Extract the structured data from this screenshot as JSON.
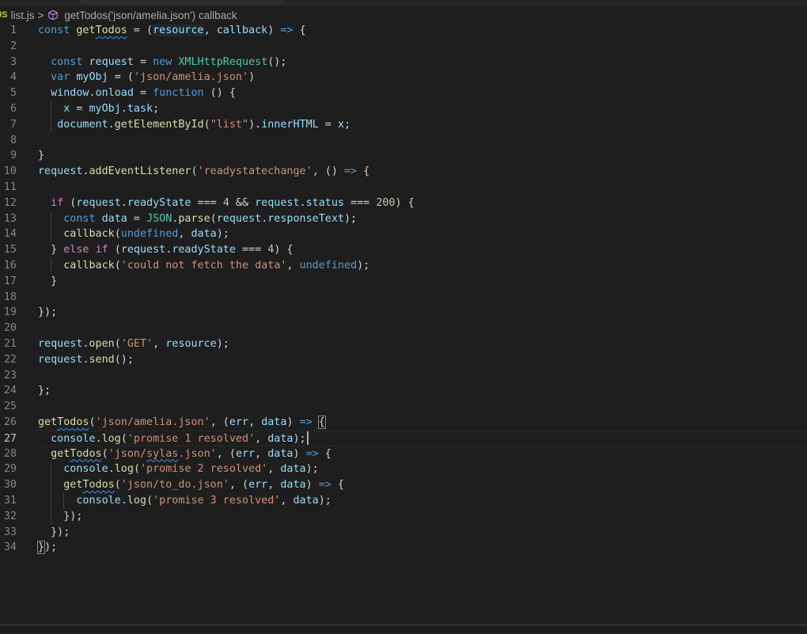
{
  "breadcrumb": {
    "file_badge": "JS",
    "file": "list.js",
    "separator": ">",
    "symbol_icon": "cube-icon",
    "symbol": "getTodos('json/amelia.json') callback"
  },
  "editor": {
    "language": "javascript",
    "current_line": 27,
    "lines": [
      {
        "n": "1",
        "text": "const getTodos = (resource, callback) => {"
      },
      {
        "n": "2",
        "text": ""
      },
      {
        "n": "3",
        "text": "  const request = new XMLHttpRequest();"
      },
      {
        "n": "4",
        "text": "  var myObj = ('json/amelia.json')"
      },
      {
        "n": "5",
        "text": "  window.onload = function () {"
      },
      {
        "n": "6",
        "text": "    x = myObj.task;"
      },
      {
        "n": "7",
        "text": "   document.getElementById(\"list\").innerHTML = x;"
      },
      {
        "n": "8",
        "text": ""
      },
      {
        "n": "9",
        "text": "}"
      },
      {
        "n": "10",
        "text": "request.addEventListener('readystatechange', () => {"
      },
      {
        "n": "11",
        "text": ""
      },
      {
        "n": "12",
        "text": "  if (request.readyState === 4 && request.status === 200) {"
      },
      {
        "n": "13",
        "text": "    const data = JSON.parse(request.responseText);"
      },
      {
        "n": "14",
        "text": "    callback(undefined, data);"
      },
      {
        "n": "15",
        "text": "  } else if (request.readyState === 4) {"
      },
      {
        "n": "16",
        "text": "    callback('could not fetch the data', undefined);"
      },
      {
        "n": "17",
        "text": "  }"
      },
      {
        "n": "18",
        "text": ""
      },
      {
        "n": "19",
        "text": "});"
      },
      {
        "n": "20",
        "text": ""
      },
      {
        "n": "21",
        "text": "request.open('GET', resource);"
      },
      {
        "n": "22",
        "text": "request.send();"
      },
      {
        "n": "23",
        "text": ""
      },
      {
        "n": "24",
        "text": "};"
      },
      {
        "n": "25",
        "text": ""
      },
      {
        "n": "26",
        "text": "getTodos('json/amelia.json', (err, data) => {"
      },
      {
        "n": "27",
        "text": "  console.log('promise 1 resolved', data);"
      },
      {
        "n": "28",
        "text": "  getTodos('json/sylas.json', (err, data) => {"
      },
      {
        "n": "29",
        "text": "    console.log('promise 2 resolved', data);"
      },
      {
        "n": "30",
        "text": "    getTodos('json/to_do.json', (err, data) => {"
      },
      {
        "n": "31",
        "text": "      console.log('promise 3 resolved', data);"
      },
      {
        "n": "32",
        "text": "    });"
      },
      {
        "n": "33",
        "text": "  });"
      },
      {
        "n": "34",
        "text": "});"
      }
    ]
  }
}
